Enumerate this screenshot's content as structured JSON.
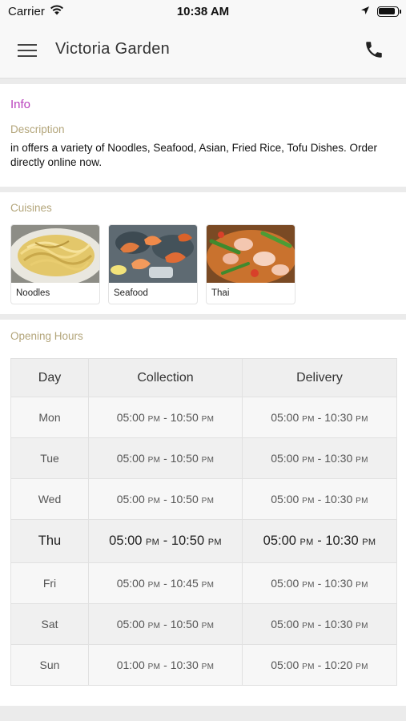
{
  "status_bar": {
    "carrier": "Carrier",
    "time": "10:38 AM"
  },
  "nav": {
    "title": "Victoria Garden"
  },
  "info": {
    "title": "Info",
    "description_label": "Description",
    "description": "in  offers a variety of Noodles, Seafood, Asian, Fried Rice, Tofu Dishes. Order directly online now."
  },
  "cuisines": {
    "label": "Cuisines",
    "items": [
      {
        "name": "Noodles"
      },
      {
        "name": "Seafood"
      },
      {
        "name": "Thai"
      }
    ]
  },
  "hours": {
    "label": "Opening Hours",
    "headers": [
      "Day",
      "Collection",
      "Delivery"
    ],
    "rows": [
      {
        "day": "Mon",
        "collection": {
          "open": "05:00",
          "open_ap": "PM",
          "close": "10:50",
          "close_ap": "PM"
        },
        "delivery": {
          "open": "05:00",
          "open_ap": "PM",
          "close": "10:30",
          "close_ap": "PM"
        }
      },
      {
        "day": "Tue",
        "collection": {
          "open": "05:00",
          "open_ap": "PM",
          "close": "10:50",
          "close_ap": "PM"
        },
        "delivery": {
          "open": "05:00",
          "open_ap": "PM",
          "close": "10:30",
          "close_ap": "PM"
        }
      },
      {
        "day": "Wed",
        "collection": {
          "open": "05:00",
          "open_ap": "PM",
          "close": "10:50",
          "close_ap": "PM"
        },
        "delivery": {
          "open": "05:00",
          "open_ap": "PM",
          "close": "10:30",
          "close_ap": "PM"
        }
      },
      {
        "day": "Thu",
        "collection": {
          "open": "05:00",
          "open_ap": "PM",
          "close": "10:50",
          "close_ap": "PM"
        },
        "delivery": {
          "open": "05:00",
          "open_ap": "PM",
          "close": "10:30",
          "close_ap": "PM"
        }
      },
      {
        "day": "Fri",
        "collection": {
          "open": "05:00",
          "open_ap": "PM",
          "close": "10:45",
          "close_ap": "PM"
        },
        "delivery": {
          "open": "05:00",
          "open_ap": "PM",
          "close": "10:30",
          "close_ap": "PM"
        }
      },
      {
        "day": "Sat",
        "collection": {
          "open": "05:00",
          "open_ap": "PM",
          "close": "10:50",
          "close_ap": "PM"
        },
        "delivery": {
          "open": "05:00",
          "open_ap": "PM",
          "close": "10:30",
          "close_ap": "PM"
        }
      },
      {
        "day": "Sun",
        "collection": {
          "open": "01:00",
          "open_ap": "PM",
          "close": "10:30",
          "close_ap": "PM"
        },
        "delivery": {
          "open": "05:00",
          "open_ap": "PM",
          "close": "10:20",
          "close_ap": "PM"
        }
      }
    ],
    "today": "Thu"
  },
  "icons": {
    "menu": "hamburger-menu-icon",
    "phone": "phone-icon",
    "wifi": "wifi-icon",
    "location": "location-arrow-icon",
    "battery": "battery-icon"
  },
  "colors": {
    "accent": "#b83fbc",
    "muted_label": "#b3a57a",
    "background": "#ebebeb"
  }
}
